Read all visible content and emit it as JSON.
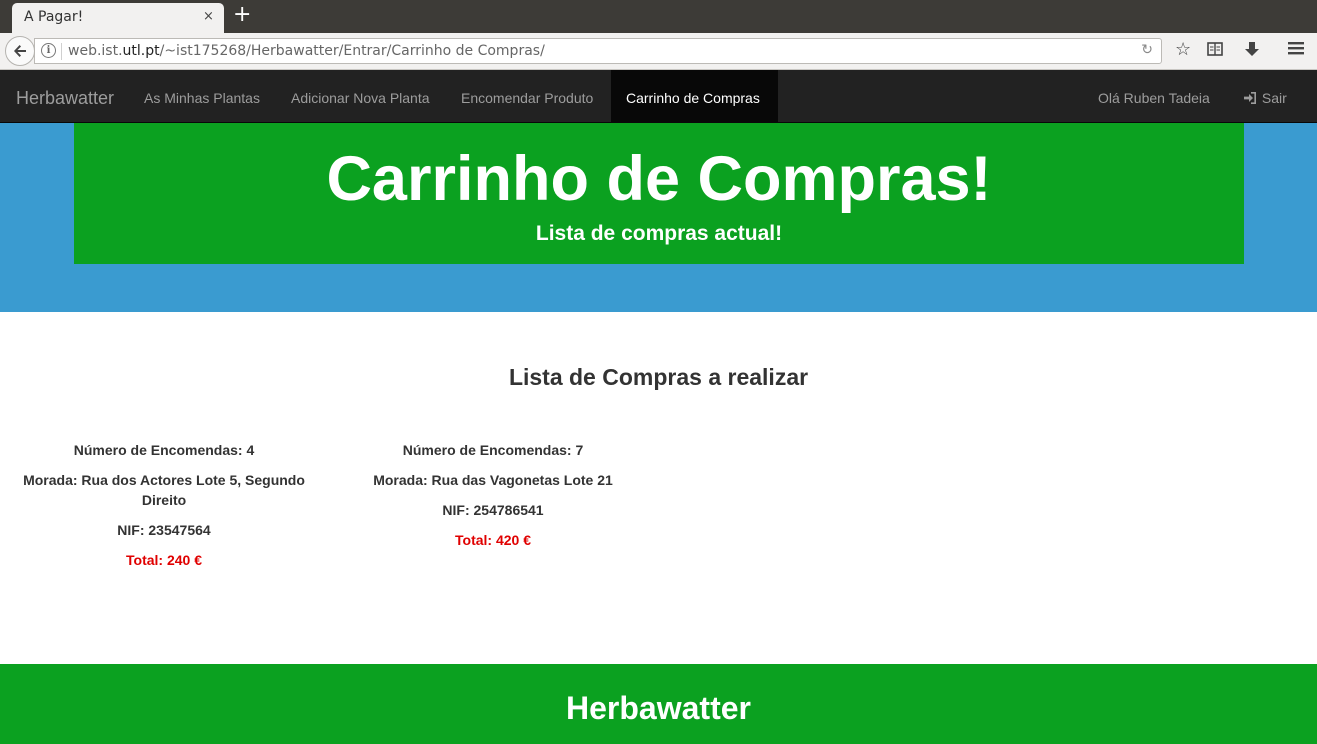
{
  "browser": {
    "tab_title": "A Pagar!",
    "tab_close": "×",
    "new_tab": "+",
    "url_prefix": "web.ist.",
    "url_domain": "utl.pt",
    "url_path": "/~ist175268/Herbawatter/Entrar/Carrinho de Compras/"
  },
  "navbar": {
    "brand": "Herbawatter",
    "items": [
      {
        "label": "As Minhas Plantas"
      },
      {
        "label": "Adicionar Nova Planta"
      },
      {
        "label": "Encomendar Produto"
      },
      {
        "label": "Carrinho de Compras"
      }
    ],
    "greeting": "Olá Ruben Tadeia",
    "logout": "Sair"
  },
  "jumbotron": {
    "title": "Carrinho de Compras!",
    "subtitle": "Lista de compras actual!"
  },
  "main": {
    "section_title": "Lista de Compras a realizar",
    "orders": [
      {
        "encomendas": "Número de Encomendas: 4",
        "morada": "Morada: Rua dos Actores Lote 5, Segundo Direito",
        "nif": "NIF: 23547564",
        "total": "Total: 240 €"
      },
      {
        "encomendas": "Número de Encomendas: 7",
        "morada": "Morada: Rua das Vagonetas Lote 21",
        "nif": "NIF: 254786541",
        "total": "Total: 420 €"
      }
    ]
  },
  "footer": {
    "title": "Herbawatter"
  },
  "colors": {
    "navbar_bg": "#222222",
    "jumbo_bg": "#3a9bd0",
    "brand_green": "#0ba120",
    "total_red": "#e00000"
  },
  "icons": {
    "back": "back-arrow-icon",
    "info": "info-icon",
    "reload": "reload-icon",
    "bookmark": "star-icon",
    "reader": "reader-icon",
    "download": "download-icon",
    "menu": "hamburger-menu-icon",
    "logout": "sign-in-icon"
  }
}
